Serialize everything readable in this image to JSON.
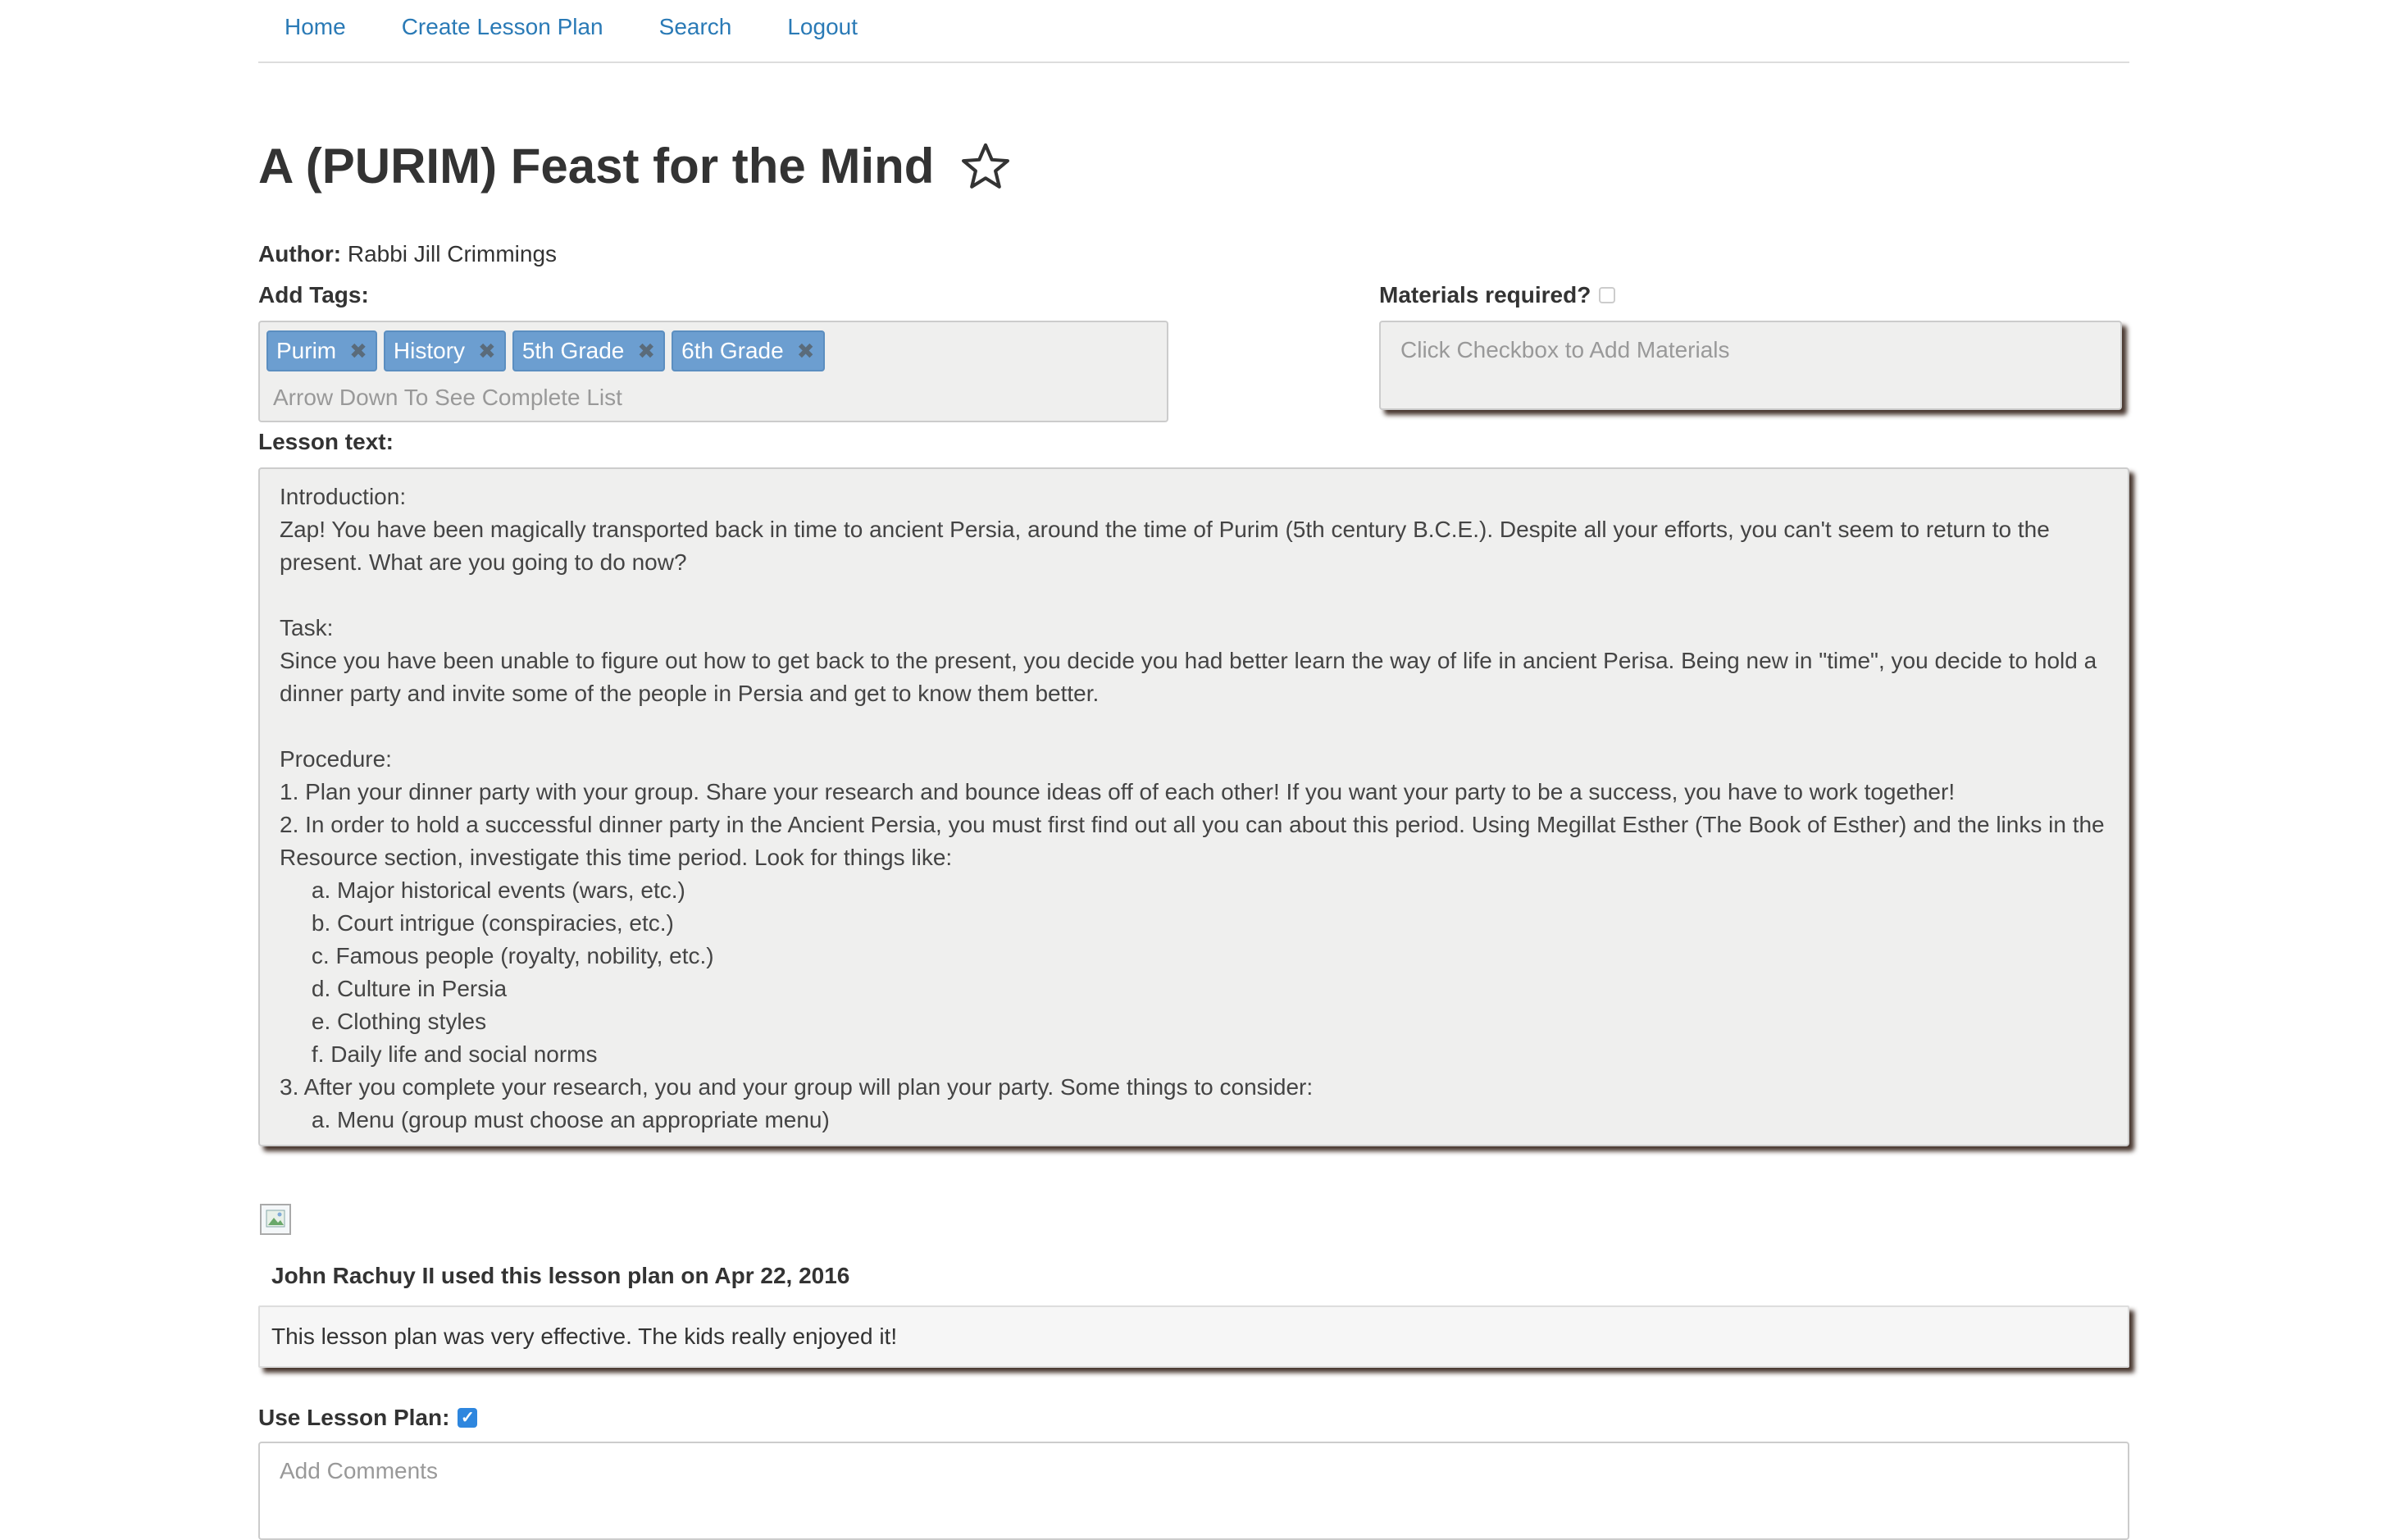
{
  "nav": {
    "items": [
      {
        "label": "Home"
      },
      {
        "label": "Create Lesson Plan"
      },
      {
        "label": "Search"
      },
      {
        "label": "Logout"
      }
    ]
  },
  "lesson": {
    "title": "A (PURIM) Feast for the Mind",
    "favorite_icon": "star-outline-icon",
    "author_label": "Author:",
    "author_name": "Rabbi Jill Crimmings"
  },
  "tags": {
    "label": "Add Tags:",
    "items": [
      {
        "label": "Purim",
        "remove_icon": "✖"
      },
      {
        "label": "History",
        "remove_icon": "✖"
      },
      {
        "label": "5th Grade",
        "remove_icon": "✖"
      },
      {
        "label": "6th Grade",
        "remove_icon": "✖"
      }
    ],
    "placeholder": "Arrow Down To See Complete List",
    "tag_color": "#6c9ed0"
  },
  "materials": {
    "label": "Materials required?",
    "checked": false,
    "placeholder": "Click Checkbox to Add Materials"
  },
  "lesson_text": {
    "label": "Lesson text:",
    "content": "Introduction:\nZap! You have been magically transported back in time to ancient Persia, around the time of Purim (5th century B.C.E.). Despite all your efforts, you can't seem to return to the present. What are you going to do now?\n\nTask:\nSince you have been unable to figure out how to get back to the present, you decide you had better learn the way of life in ancient Perisa. Being new in \"time\", you decide to hold a dinner party and invite some of the people in Persia and get to know them better.\n\nProcedure:\n1. Plan your dinner party with your group. Share your research and bounce ideas off of each other! If you want your party to be a success, you have to work together!\n2. In order to hold a successful dinner party in the Ancient Persia, you must first find out all you can about this period. Using Megillat Esther (The Book of Esther) and the links in the Resource section, investigate this time period. Look for things like:\n     a. Major historical events (wars, etc.)\n     b. Court intrigue (conspiracies, etc.)\n     c. Famous people (royalty, nobility, etc.)\n     d. Culture in Persia\n     e. Clothing styles\n     f. Daily life and social norms\n3. After you complete your research, you and your group will plan your party. Some things to consider:\n     a. Menu (group must choose an appropriate menu)"
  },
  "comment": {
    "header": "John Rachuy II used this lesson plan on Apr 22, 2016",
    "text": "This lesson plan was very effective. The kids really enjoyed it!"
  },
  "use_plan": {
    "label": "Use Lesson Plan:",
    "checked": true,
    "check_glyph": "✓",
    "comments_placeholder": "Add Comments"
  }
}
